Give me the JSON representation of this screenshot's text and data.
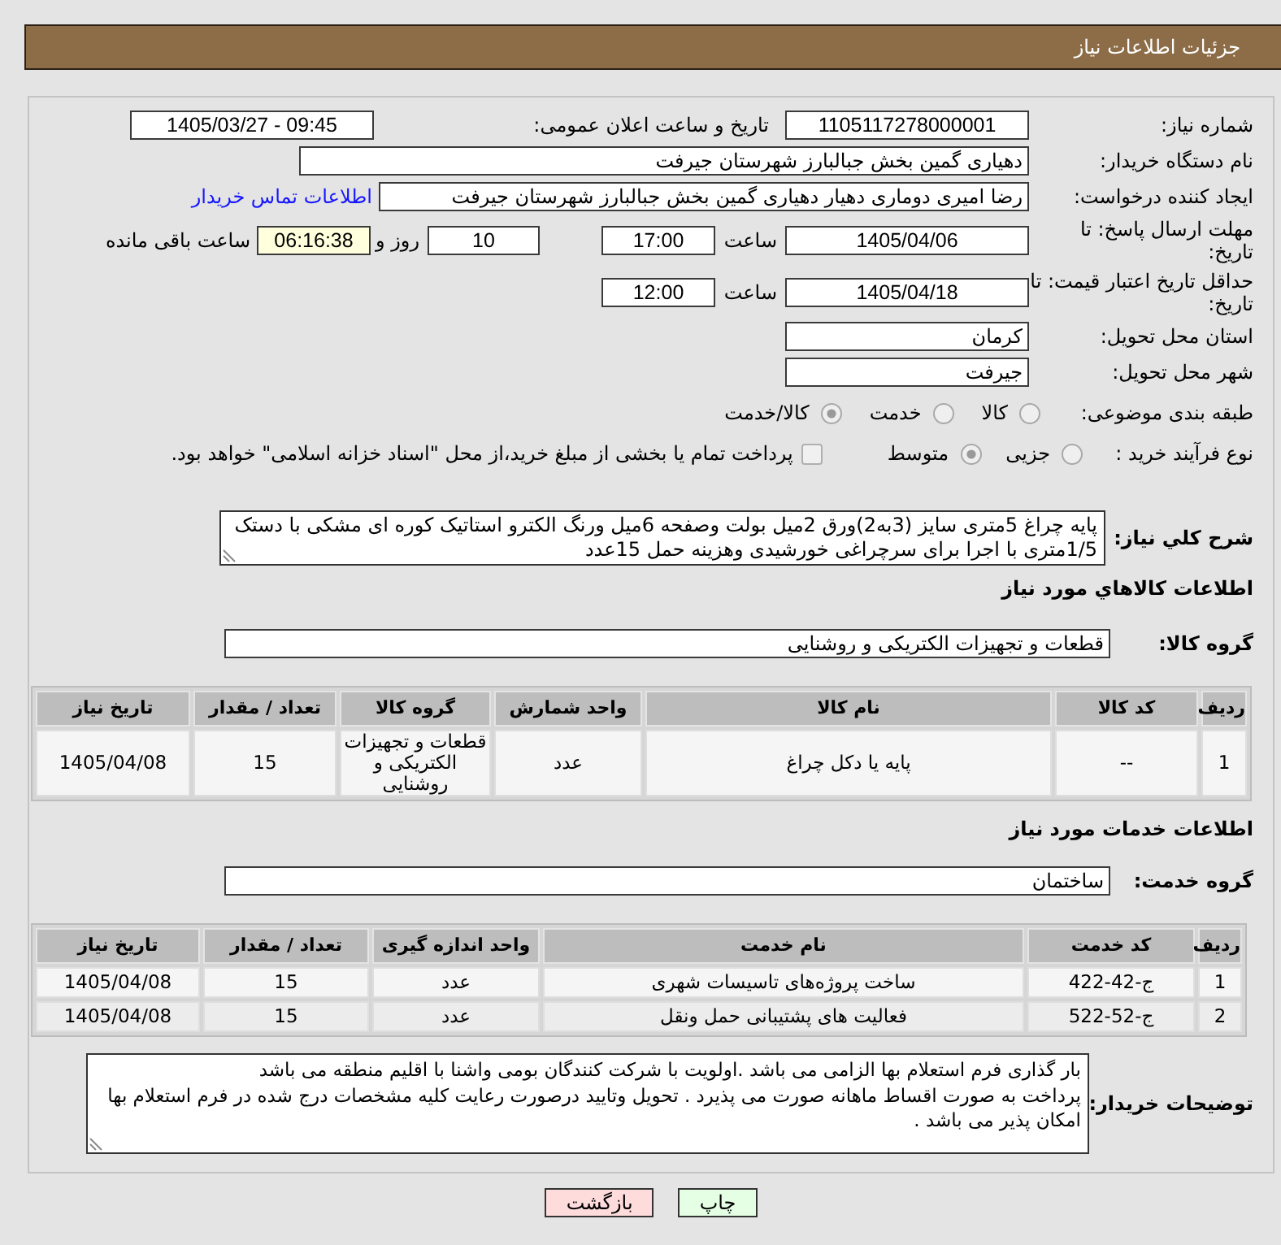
{
  "header": {
    "title": "جزئیات اطلاعات نیاز"
  },
  "need_number": {
    "label": "شماره نیاز:",
    "value": "1105117278000001"
  },
  "announcement": {
    "label": "تاریخ و ساعت اعلان عمومی:",
    "value": "1405/03/27 - 09:45"
  },
  "buyer_org": {
    "label": "نام دستگاه خریدار:",
    "value": "دهیاری گمین بخش جبالبارز شهرستان جیرفت"
  },
  "requester": {
    "label": "ایجاد کننده درخواست:",
    "value": "رضا امیری دوماری دهیار دهیاری گمین بخش جبالبارز شهرستان جیرفت",
    "link": "اطلاعات تماس خریدار"
  },
  "response_deadline": {
    "label": "مهلت ارسال پاسخ: تا تاریخ:",
    "date": "1405/04/06",
    "time_label": "ساعت",
    "time": "17:00",
    "days": "10",
    "days_label": "روز و",
    "remaining": "06:16:38",
    "remaining_label": "ساعت باقی مانده"
  },
  "price_validity": {
    "label": "حداقل تاریخ اعتبار قیمت: تا تاریخ:",
    "date": "1405/04/18",
    "time_label": "ساعت",
    "time": "12:00"
  },
  "delivery_province": {
    "label": "استان محل تحویل:",
    "value": "کرمان"
  },
  "delivery_city": {
    "label": "شهر محل تحویل:",
    "value": "جیرفت"
  },
  "classification": {
    "label": "طبقه بندی موضوعی:",
    "disabled": true,
    "options": [
      {
        "label": "کالا",
        "selected": false
      },
      {
        "label": "خدمت",
        "selected": false
      },
      {
        "label": "کالا/خدمت",
        "selected": true
      }
    ]
  },
  "purchase_process": {
    "label": "نوع فرآیند خرید :",
    "disabled": true,
    "options": [
      {
        "label": "جزیی",
        "selected": false
      },
      {
        "label": "متوسط",
        "selected": true
      }
    ],
    "treasury_payment": {
      "label": "پرداخت تمام یا بخشی از مبلغ خرید،از محل \"اسناد خزانه اسلامی\" خواهد بود.",
      "checked": false
    }
  },
  "description": {
    "label": "شرح کلي نياز:",
    "value": "پایه چراغ 5متری سایز (3به2)ورق 2میل بولت وصفحه 6میل ورنگ الکترو استاتیک کوره ای مشکی با دستک 1/5متری با اجرا برای سرچراغی خورشیدی وهزینه حمل 15عدد"
  },
  "goods": {
    "title": "اطلاعات کالاهاي مورد نياز",
    "group_label": "گروه کالا:",
    "group": "قطعات و تجهیزات الکتریکی و روشنایی",
    "columns": [
      "ردیف",
      "کد کالا",
      "نام کالا",
      "واحد شمارش",
      "گروه کالا",
      "تعداد / مقدار",
      "تاریخ نیاز"
    ],
    "rows": [
      [
        "1",
        "--",
        "پایه یا دکل چراغ",
        "عدد",
        "قطعات و تجهیزات الکتریکی و روشنایی",
        "15",
        "1405/04/08"
      ]
    ]
  },
  "services": {
    "title": "اطلاعات خدمات مورد نیاز",
    "group_label": "گروه خدمت:",
    "group": "ساختمان",
    "columns": [
      "ردیف",
      "کد خدمت",
      "نام خدمت",
      "واحد اندازه گیری",
      "تعداد / مقدار",
      "تاریخ نیاز"
    ],
    "rows": [
      [
        "1",
        "ج-42-422",
        "ساخت پروژه‌های تاسیسات شهری",
        "عدد",
        "15",
        "1405/04/08"
      ],
      [
        "2",
        "ج-52-522",
        "فعالیت های پشتیبانی حمل ونقل",
        "عدد",
        "15",
        "1405/04/08"
      ]
    ]
  },
  "buyer_notes": {
    "label": "توضیحات خریدار:",
    "value": "بار گذاری فرم استعلام بها الزامی می باشد .اولویت با شرکت کنندگان بومی واشنا با اقلیم منطقه می باشد\nپرداخت به صورت اقساط ماهانه صورت می پذیرد . تحویل وتایید  درصورت رعایت کلیه مشخصات درج شده در فرم استعلام بها امکان پذیر می باشد ."
  },
  "buttons": [
    {
      "label": "چاپ",
      "kind": "print"
    },
    {
      "label": "بازگشت",
      "kind": "back"
    }
  ]
}
